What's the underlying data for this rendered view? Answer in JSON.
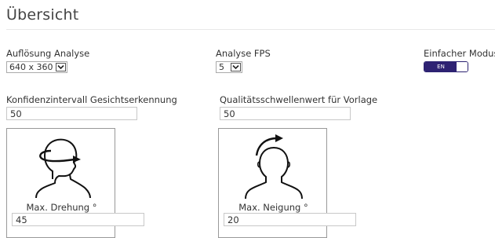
{
  "page": {
    "title": "Übersicht"
  },
  "fields": {
    "resolution": {
      "label": "Auflösung Analyse",
      "value": "640 x 360"
    },
    "fps": {
      "label": "Analyse FPS",
      "value": "5"
    },
    "simple_mode": {
      "label": "Einfacher Modus",
      "toggle_text": "EN",
      "state": "on"
    },
    "confidence": {
      "label": "Konfidenzintervall Gesichtserkennung",
      "value": "50"
    },
    "quality": {
      "label": "Qualitätsschwellenwert für Vorlage",
      "value": "50"
    }
  },
  "cards": {
    "rotation": {
      "caption": "Max. Drehung °",
      "value": "45",
      "icon": "head-turn-icon"
    },
    "tilt": {
      "caption": "Max. Neigung °",
      "value": "20",
      "icon": "head-tilt-icon"
    }
  }
}
